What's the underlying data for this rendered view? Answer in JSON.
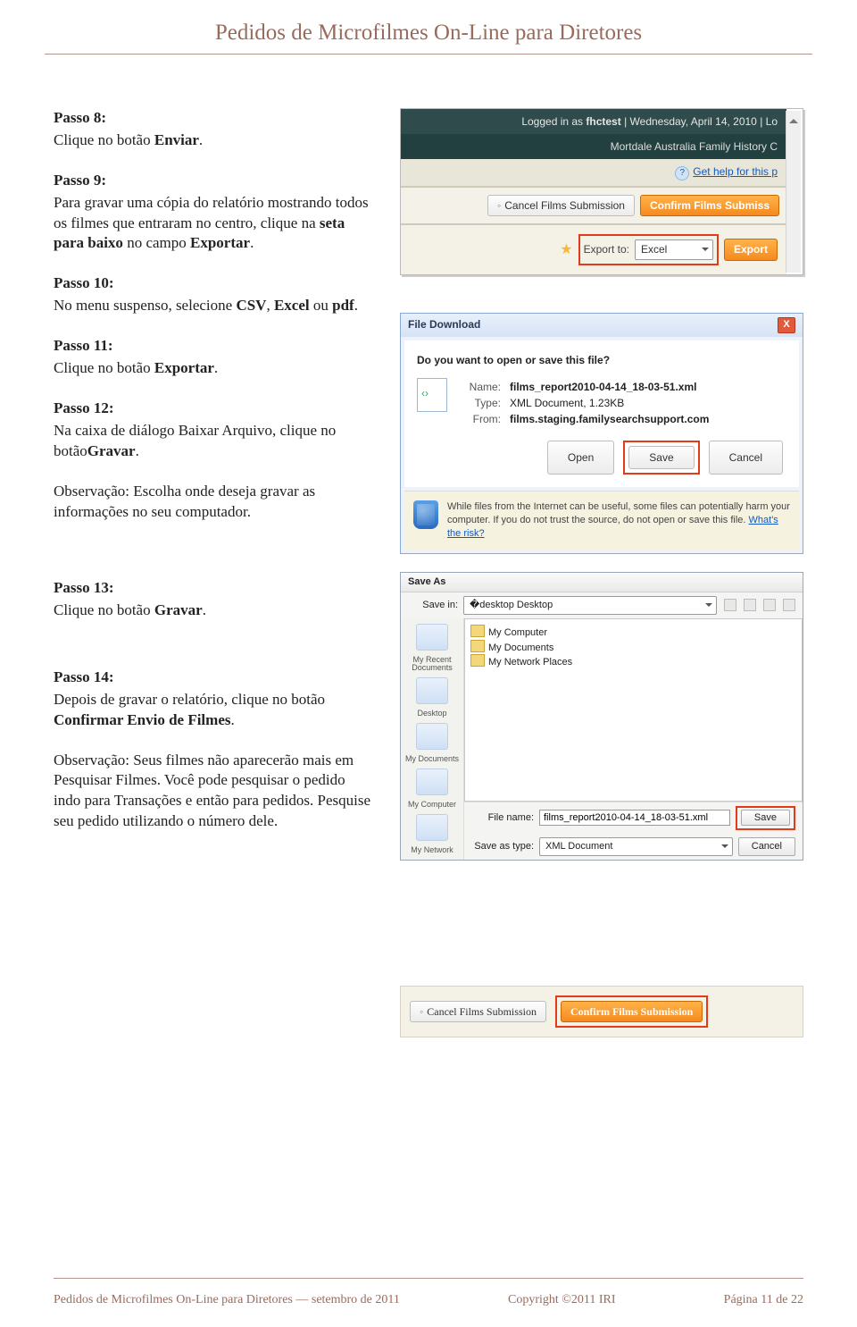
{
  "doc": {
    "header_title": "Pedidos de Microfilmes On-Line para Diretores",
    "footer_left": "Pedidos de Microfilmes On-Line para Diretores — setembro de 2011",
    "footer_center": "Copyright ©2011 IRI",
    "footer_right": "Página 11 de 22"
  },
  "steps": {
    "s8": {
      "title": "Passo 8:",
      "text_a": "Clique no botão ",
      "bold": "Enviar",
      "tail": "."
    },
    "s9": {
      "title": "Passo 9:",
      "text": "Para gravar uma cópia do relatório mostrando todos os filmes que entraram no centro, clique na ",
      "b1": "seta para baixo",
      "mid": " no campo ",
      "b2": "Exportar",
      "tail": "."
    },
    "s10": {
      "title": "Passo 10:",
      "t1": "No menu suspenso, selecione ",
      "b1": "CSV",
      "t2": ", ",
      "b2": "Excel",
      "t3": " ou ",
      "b3": "pdf",
      "tail": "."
    },
    "s11": {
      "title": "Passo 11:",
      "t1": "Clique no botão ",
      "b1": "Exportar",
      "tail": "."
    },
    "s12": {
      "title": "Passo 12:",
      "t1": "Na caixa de diálogo Baixar Arquivo, clique no botão",
      "b1": "Gravar",
      "tail": "."
    },
    "obsA": {
      "lead": "Observação:",
      "text": " Escolha onde deseja gravar as informações no seu computador."
    },
    "s13": {
      "title": "Passo 13:",
      "t1": "Clique no botão ",
      "b1": "Gravar",
      "tail": "."
    },
    "s14": {
      "title": "Passo 14:",
      "t1": "Depois de gravar o relatório, clique no botão ",
      "b1": "Confirmar Envio de Filmes",
      "tail": "."
    },
    "obsB": {
      "lead": "Observação:",
      "text": "  Seus filmes não aparecerão mais em Pesquisar Filmes. Você pode pesquisar o pedido indo para Transações e então para pedidos. Pesquise seu pedido utilizando o número dele."
    }
  },
  "shot1": {
    "logged_prefix": "Logged in as ",
    "user": "fhctest",
    "sep": "  |  ",
    "date": "Wednesday, April 14, 2010",
    "tail": "  |  Lo",
    "sub": "Mortdale Australia Family History C",
    "help": "Get help for this p",
    "cancel": "Cancel Films Submission",
    "confirm": "Confirm Films Submiss",
    "export_label": "Export to:",
    "export_value": "Excel",
    "export_btn": "Export"
  },
  "dlg": {
    "title": "File Download",
    "question": "Do you want to open or save this file?",
    "name_k": "Name:",
    "name_v": "films_report2010-04-14_18-03-51.xml",
    "type_k": "Type:",
    "type_v": "XML Document, 1.23KB",
    "from_k": "From:",
    "from_v": "films.staging.familysearchsupport.com",
    "open": "Open",
    "save": "Save",
    "cancel": "Cancel",
    "warn": "While files from the Internet can be useful, some files can potentially harm your computer. If you do not trust the source, do not open or save this file. ",
    "risk": "What's the risk?"
  },
  "save": {
    "title": "Save As",
    "savein": "Save in:",
    "savein_val": "Desktop",
    "items": [
      "My Computer",
      "My Documents",
      "My Network Places"
    ],
    "side": [
      "My Recent Documents",
      "Desktop",
      "My Documents",
      "My Computer",
      "My Network"
    ],
    "fname": "File name:",
    "fname_val": "films_report2010-04-14_18-03-51.xml",
    "ftype": "Save as type:",
    "ftype_val": "XML Document",
    "save_btn": "Save",
    "cancel_btn": "Cancel"
  },
  "shot3": {
    "cancel": "Cancel Films Submission",
    "confirm": "Confirm Films Submission"
  }
}
